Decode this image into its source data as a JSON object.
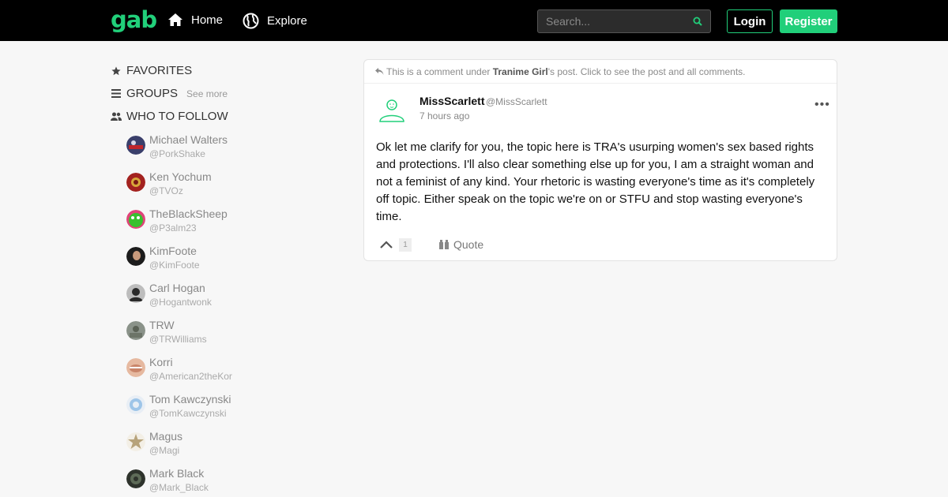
{
  "header": {
    "logo": "gab",
    "nav": [
      {
        "label": "Home",
        "icon": "home-icon"
      },
      {
        "label": "Explore",
        "icon": "globe-icon"
      }
    ],
    "search_placeholder": "Search...",
    "login_label": "Login",
    "register_label": "Register",
    "accent_color": "#21cf7a"
  },
  "sidebar": {
    "favorites_label": "FAVORITES",
    "groups_label": "GROUPS",
    "groups_see_more": "See more",
    "who_to_follow_label": "WHO TO FOLLOW",
    "follow": [
      {
        "name": "Michael Walters",
        "handle": "@PorkShake"
      },
      {
        "name": "Ken Yochum",
        "handle": "@TVOz"
      },
      {
        "name": "TheBlackSheep",
        "handle": "@P3alm23"
      },
      {
        "name": "KimFoote",
        "handle": "@KimFoote"
      },
      {
        "name": "Carl Hogan",
        "handle": "@Hogantwonk"
      },
      {
        "name": "TRW",
        "handle": "@TRWilliams"
      },
      {
        "name": "Korri",
        "handle": "@American2theKor"
      },
      {
        "name": "Tom Kawczynski",
        "handle": "@TomKawczynski"
      },
      {
        "name": "Magus",
        "handle": "@Magi"
      },
      {
        "name": "Mark Black",
        "handle": "@Mark_Black"
      }
    ]
  },
  "post": {
    "notice_prefix": "This is a comment under ",
    "notice_author": "Tranime Girl",
    "notice_suffix": "'s post. Click to see the post and all comments.",
    "author_name": "MissScarlett",
    "author_handle": "@MissScarlett",
    "time": "7 hours ago",
    "more": "•••",
    "body": "Ok let me clarify for you, the topic here is TRA's usurping women's sex based rights and protections. I'll also clear something else up for you, I am a straight woman and not a feminist of any kind. Your rhetoric is wasting everyone's time as it's completely off topic. Either speak on the topic we're on or STFU and stop wasting everyone's time.",
    "upvote_count": "1",
    "quote_label": "Quote"
  }
}
